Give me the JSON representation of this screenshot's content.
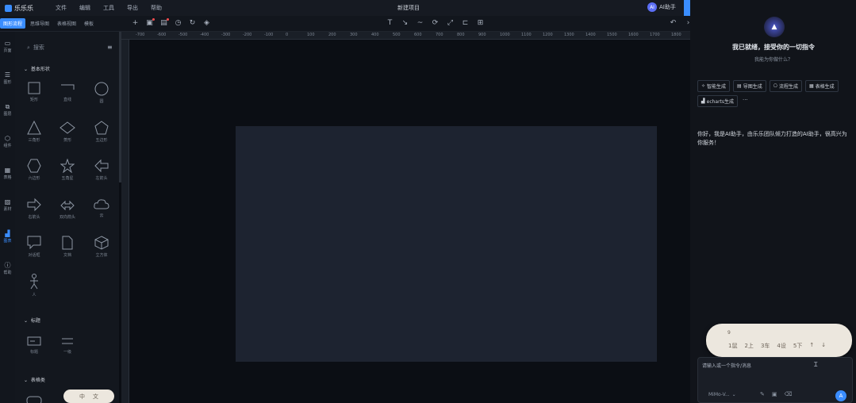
{
  "app": {
    "name": "乐乐乐",
    "document_title": "新建项目"
  },
  "menu": [
    "文件",
    "编辑",
    "工具",
    "导出",
    "帮助"
  ],
  "topbar": {
    "ai_button_label": "AI助手",
    "ai_avatar": "AI"
  },
  "mode_tabs": [
    "图形流程",
    "思维导图",
    "表格视图",
    "模板"
  ],
  "rail": [
    {
      "icon": "monitor-icon",
      "label": "页面"
    },
    {
      "icon": "list-icon",
      "label": "图形"
    },
    {
      "icon": "layers-icon",
      "label": "图层"
    },
    {
      "icon": "cube-icon",
      "label": "组件"
    },
    {
      "icon": "table-icon",
      "label": "表格"
    },
    {
      "icon": "image-icon",
      "label": "素材"
    },
    {
      "icon": "chart-icon",
      "label": "图表"
    },
    {
      "icon": "help-icon",
      "label": "帮助"
    }
  ],
  "library": {
    "search_placeholder": "搜索",
    "sections": {
      "basic": "基本形状",
      "title": "标题",
      "table": "表格类"
    },
    "basic_shapes": [
      "矩形",
      "直线",
      "圆",
      "三角形",
      "菱形",
      "五边形",
      "六边形",
      "五角星",
      "左箭头",
      "右箭头",
      "双向箭头",
      "云",
      "对话框",
      "文档",
      "立方体",
      "人"
    ],
    "title_shapes": [
      "标题",
      "一级"
    ]
  },
  "ruler": {
    "ticks": [
      "-700",
      "-600",
      "-500",
      "-400",
      "-300",
      "-200",
      "-100",
      "0",
      "100",
      "200",
      "300",
      "400",
      "500",
      "600",
      "700",
      "800",
      "900",
      "1000",
      "1100",
      "1200",
      "1300",
      "1400",
      "1500",
      "1600",
      "1700",
      "1800"
    ]
  },
  "ai_panel": {
    "title": "我已就绪，接受你的一切指令",
    "subtitle": "我能为你做什么？",
    "chips": [
      {
        "icon": "sparkle-icon",
        "label": "智能生成"
      },
      {
        "icon": "doc-icon",
        "label": "导图生成"
      },
      {
        "icon": "flow-icon",
        "label": "流程生成"
      },
      {
        "icon": "table-icon",
        "label": "表格生成"
      },
      {
        "icon": "chart-icon",
        "label": "echarts生成"
      }
    ],
    "more_label": "···",
    "message": "你好，我是AI助手，由乐乐团队倾力打造的AI助手，很高兴为你服务！",
    "pager_number": "9",
    "pager": [
      "1鼠",
      "2上",
      "3车",
      "4设",
      "5下",
      "↑",
      "↓"
    ],
    "input_placeholder": "请输入或一个指令/消息",
    "model_label": "MiMo-V...",
    "send_icon": "A"
  },
  "ime": [
    "中",
    "文"
  ]
}
